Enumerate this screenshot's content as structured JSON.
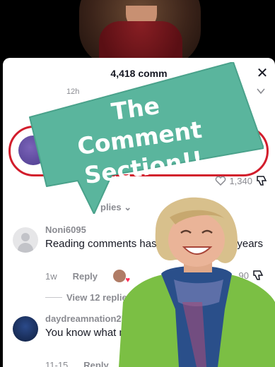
{
  "sheet": {
    "title": "4,418 comm",
    "close_label": "✕",
    "stub_time": "12h"
  },
  "highlight": {
    "likes": "1,340",
    "view_replies": "plies ⌄"
  },
  "overlay": {
    "bubble_text": "The Comment Section!!",
    "bubble_color": "#5ab59d",
    "ring_color": "#d21d2c"
  },
  "comments": [
    {
      "user": "Noni6095",
      "text": "Reading comments has b           fun I've had in years",
      "age": "1w",
      "reply_label": "Reply",
      "likes": "90",
      "view_replies": "View 12 replies"
    },
    {
      "user": "daydreamnation25",
      "text": "You know what mayb better than I though",
      "age": "11-15",
      "reply_label": "Reply"
    }
  ]
}
